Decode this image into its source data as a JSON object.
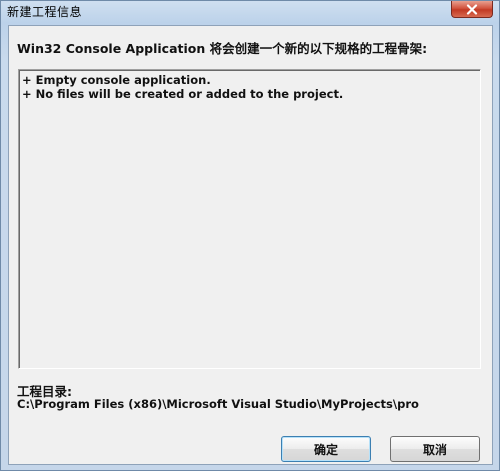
{
  "window": {
    "title": "新建工程信息"
  },
  "dialog": {
    "description": "Win32 Console Application 将会创建一个新的以下规格的工程骨架:",
    "info_lines": [
      "+ Empty console application.",
      "+ No files will be created or added to the project."
    ],
    "directory_label": "工程目录:",
    "directory_path": "C:\\Program Files (x86)\\Microsoft Visual Studio\\MyProjects\\pro"
  },
  "buttons": {
    "ok_label": "确定",
    "cancel_label": "取消"
  },
  "icons": {
    "close": "close-icon"
  }
}
